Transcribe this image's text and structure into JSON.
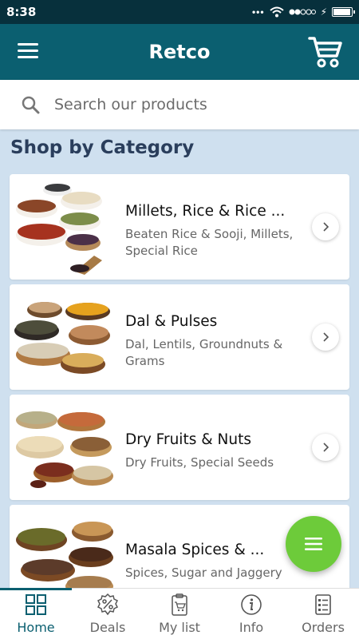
{
  "status": {
    "time": "8:38",
    "battery_level": 0.95
  },
  "app": {
    "title": "Retco"
  },
  "search": {
    "placeholder": "Search our products"
  },
  "section": {
    "title": "Shop by Category"
  },
  "categories": [
    {
      "title": "Millets, Rice & Rice ...",
      "subtitle": "Beaten Rice & Sooji, Millets, Special Rice",
      "image": "millets-rice-image"
    },
    {
      "title": "Dal & Pulses",
      "subtitle": "Dal, Lentils, Groundnuts & Grams",
      "image": "dal-pulses-image"
    },
    {
      "title": "Dry Fruits & Nuts",
      "subtitle": "Dry Fruits, Special Seeds",
      "image": "dry-fruits-nuts-image"
    },
    {
      "title": "Masala Spices & ...",
      "subtitle": "Spices, Sugar and Jaggery",
      "image": "masala-spices-image"
    }
  ],
  "bottom_nav": {
    "items": [
      {
        "label": "Home",
        "icon": "grid-icon",
        "active": true
      },
      {
        "label": "Deals",
        "icon": "percent-badge-icon",
        "active": false
      },
      {
        "label": "My list",
        "icon": "shopping-list-icon",
        "active": false
      },
      {
        "label": "Info",
        "icon": "info-icon",
        "active": false
      },
      {
        "label": "Orders",
        "icon": "orders-icon",
        "active": false
      }
    ]
  },
  "colors": {
    "primary": "#0b5f70",
    "status_bar": "#07303c",
    "fab": "#6dcb3a",
    "background": "#cfe0ef",
    "heading": "#2a3e5c"
  }
}
